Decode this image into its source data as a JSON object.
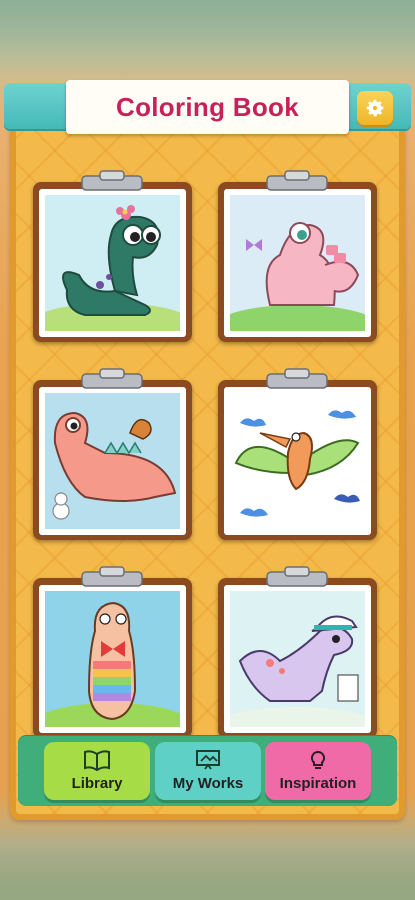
{
  "header": {
    "title": "Coloring Book",
    "settings_icon": "gear-icon"
  },
  "gallery": {
    "items": [
      {
        "name": "dinosaur-green-flower"
      },
      {
        "name": "dinosaur-pink-butterfly"
      },
      {
        "name": "dinosaur-pink-bird"
      },
      {
        "name": "pterodactyl-clouds"
      },
      {
        "name": "dinosaur-rainbow-bowtie"
      },
      {
        "name": "dinosaur-purple-hat"
      }
    ]
  },
  "tabs": [
    {
      "label": "Library",
      "icon": "book-icon",
      "color": "#a6dc45"
    },
    {
      "label": "My Works",
      "icon": "picture-icon",
      "color": "#5fd0c6"
    },
    {
      "label": "Inspiration",
      "icon": "bulb-icon",
      "color": "#f06aa7"
    }
  ],
  "colors": {
    "title": "#c8215a",
    "header": "#44b9b8",
    "board": "#f3b94a",
    "card": "#8b4a1f"
  }
}
